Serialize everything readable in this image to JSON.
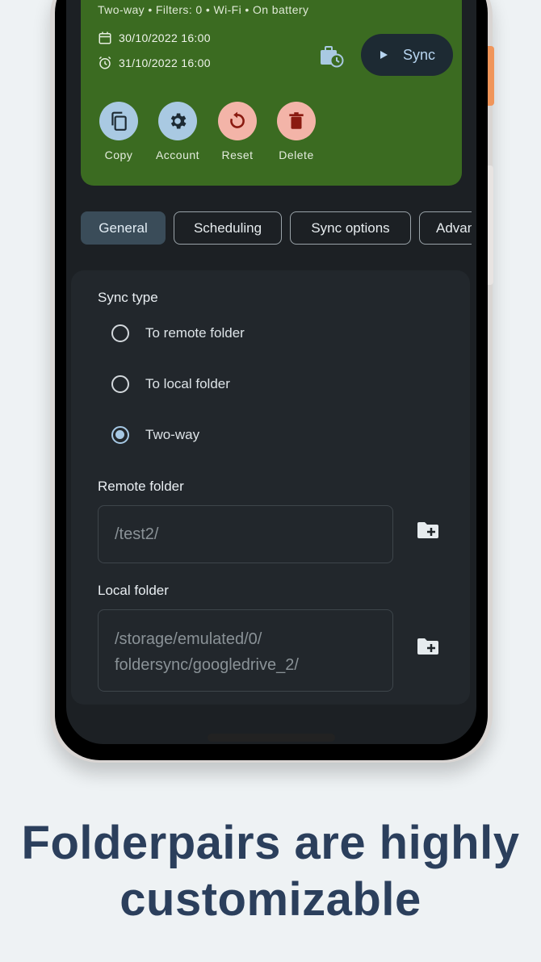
{
  "card": {
    "status_line": "Two-way  •  Filters: 0  •  Wi-Fi  •  On battery",
    "last_sync": "30/10/2022 16:00",
    "next_sync": "31/10/2022 16:00",
    "sync_label": "Sync",
    "actions": [
      {
        "label": "Copy",
        "icon": "copy-icon",
        "color": "#a9c9e2"
      },
      {
        "label": "Account",
        "icon": "gear-icon",
        "color": "#a9c9e2"
      },
      {
        "label": "Reset",
        "icon": "reset-icon",
        "color": "#f3b4a8"
      },
      {
        "label": "Delete",
        "icon": "trash-icon",
        "color": "#f3b4a8"
      }
    ]
  },
  "tabs": [
    {
      "label": "General",
      "active": true
    },
    {
      "label": "Scheduling",
      "active": false
    },
    {
      "label": "Sync options",
      "active": false
    },
    {
      "label": "Advan",
      "active": false
    }
  ],
  "sync_type": {
    "heading": "Sync type",
    "options": [
      {
        "label": "To remote folder",
        "selected": false
      },
      {
        "label": "To local folder",
        "selected": false
      },
      {
        "label": "Two-way",
        "selected": true
      }
    ]
  },
  "remote_folder": {
    "heading": "Remote folder",
    "value": "/test2/"
  },
  "local_folder": {
    "heading": "Local folder",
    "value_line1": "/storage/emulated/0/",
    "value_line2": "foldersync/googledrive_2/"
  },
  "headline": {
    "line1": "Folderpairs are highly",
    "line2": "customizable"
  },
  "colors": {
    "card_green": "#3b6b21",
    "accent_blue": "#a6c8e4",
    "headline": "#2b3f5c"
  }
}
